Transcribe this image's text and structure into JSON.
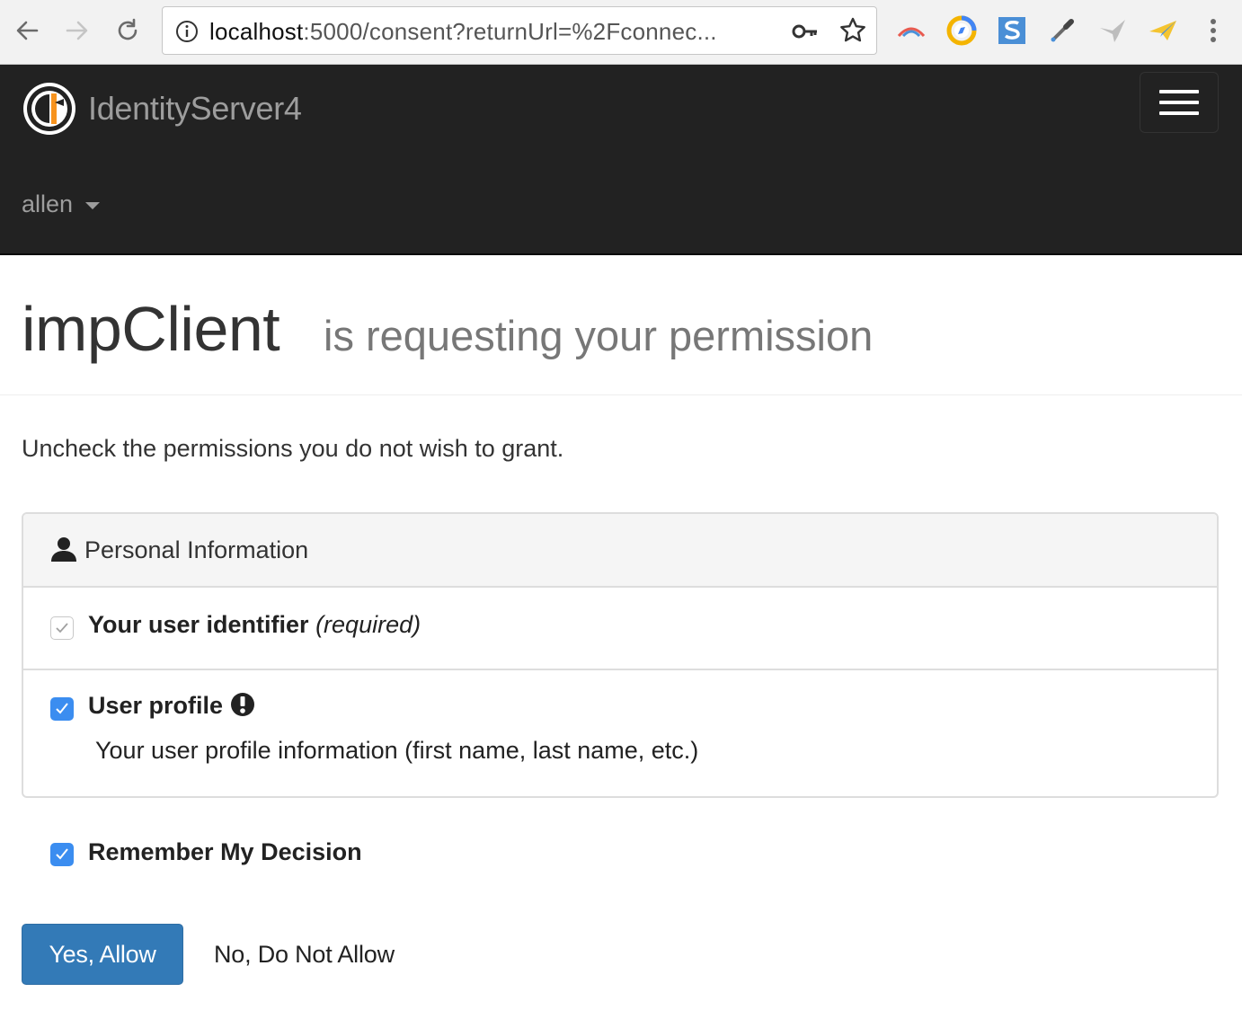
{
  "browser": {
    "url_host": "localhost",
    "url_path": ":5000/consent?returnUrl=%2Fconnec..."
  },
  "navbar": {
    "brand": "IdentityServer4",
    "user": "allen"
  },
  "header": {
    "client_name": "impClient",
    "subtitle": "is requesting your permission"
  },
  "instruction": "Uncheck the permissions you do not wish to grant.",
  "panel": {
    "heading": "Personal Information",
    "items": [
      {
        "label": "Your user identifier",
        "note": "(required)",
        "checked": true,
        "disabled": true
      },
      {
        "label": "User profile",
        "description": "Your user profile information (first name, last name, etc.)",
        "checked": true,
        "disabled": false
      }
    ]
  },
  "remember": {
    "label": "Remember My Decision",
    "checked": true
  },
  "buttons": {
    "allow": "Yes, Allow",
    "deny": "No, Do Not Allow"
  },
  "colors": {
    "navbar": "#222222",
    "primary": "#337ab7",
    "checkbox": "#3b8df0"
  }
}
